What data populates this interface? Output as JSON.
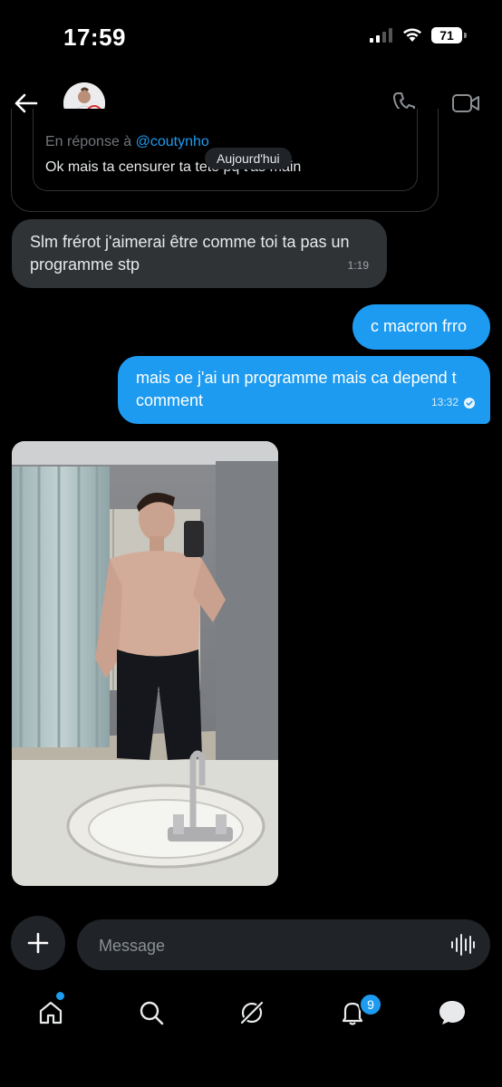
{
  "status_bar": {
    "time": "17:59",
    "battery": "71"
  },
  "header": {
    "avatar_icon": "profile-photo",
    "call_icon": "phone-icon",
    "video_icon": "video-camera-icon"
  },
  "reply": {
    "label_prefix": "En réponse à ",
    "handle": "@coutynho",
    "quoted_text": "Ok mais ta censurer ta tete pq t'as main"
  },
  "day_separator": "Aujourd'hui",
  "messages": [
    {
      "direction": "received",
      "text": "Slm frérot j'aimerai être comme toi ta pas un programme stp",
      "time": "1:19"
    },
    {
      "direction": "sent",
      "text": "c macron frro"
    },
    {
      "direction": "sent",
      "text": "mais oe j'ai un programme mais ca depend t comment",
      "time": "13:32",
      "status": "read"
    }
  ],
  "photo": {
    "description_icon": "mirror-selfie-photo"
  },
  "composer": {
    "placeholder": "Message",
    "add_icon": "plus-icon",
    "voice_icon": "voice-wave-icon"
  },
  "tab_bar": {
    "items": [
      "home-icon",
      "search-icon",
      "grok-icon",
      "bell-icon",
      "messages-icon"
    ],
    "notification_count": "9"
  },
  "colors": {
    "accent": "#1d9bf0",
    "bubble_received": "#2f3336",
    "background": "#000000"
  }
}
